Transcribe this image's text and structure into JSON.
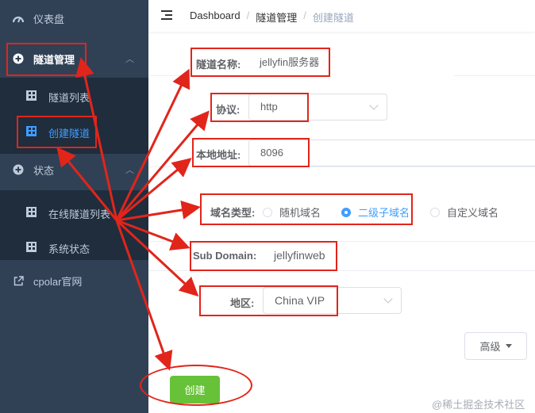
{
  "sidebar": {
    "dashboard_label": "仪表盘",
    "tunnel_mgmt_label": "隧道管理",
    "tunnel_list_label": "隧道列表",
    "create_tunnel_label": "创建隧道",
    "status_label": "状态",
    "online_tunnels_label": "在线隧道列表",
    "system_status_label": "系统状态",
    "cpolar_site_label": "cpolar官网"
  },
  "breadcrumb": {
    "home": "Dashboard",
    "sep": "/",
    "section": "隧道管理",
    "current": "创建隧道"
  },
  "form": {
    "name_label": "隧道名称:",
    "name_value": "jellyfin服务器",
    "protocol_label": "协议:",
    "protocol_value": "http",
    "local_addr_label": "本地地址:",
    "local_addr_value": "8096",
    "domain_type_label": "域名类型:",
    "domain_type_options": [
      "随机域名",
      "二级子域名",
      "自定义域名"
    ],
    "domain_type_selected": "二级子域名",
    "subdomain_label": "Sub Domain:",
    "subdomain_value": "jellyfinweb",
    "region_label": "地区:",
    "region_value": "China VIP",
    "advanced_label": "高级",
    "create_label": "创建"
  },
  "watermark": "@稀土掘金技术社区",
  "colors": {
    "sidebar_bg": "#304156",
    "active_blue": "#409eff",
    "create_green": "#67c23a",
    "annotation_red": "#e1251b"
  }
}
